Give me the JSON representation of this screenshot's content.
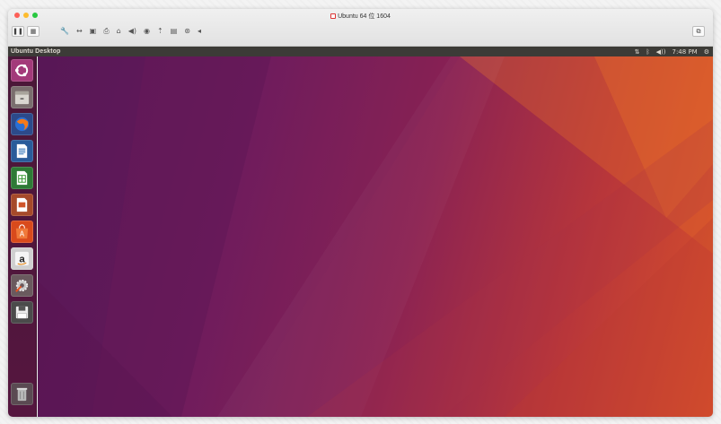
{
  "vm_window": {
    "title": "Ubuntu 64 位 1604",
    "traffic_lights": [
      "close",
      "minimize",
      "maximize"
    ],
    "toolbar": {
      "left_buttons": [
        {
          "name": "pause-button",
          "glyph": "❚❚"
        },
        {
          "name": "snapshot-button",
          "glyph": "▦"
        }
      ],
      "device_icons": [
        {
          "name": "settings-wrench-icon",
          "glyph": "🔧"
        },
        {
          "name": "resize-icon",
          "glyph": "↔"
        },
        {
          "name": "disk-icon",
          "glyph": "▣"
        },
        {
          "name": "printer-icon",
          "glyph": "⎙"
        },
        {
          "name": "camera-icon",
          "glyph": "⌂"
        },
        {
          "name": "sound-icon",
          "glyph": "◀)"
        },
        {
          "name": "usb-icon",
          "glyph": "◉"
        },
        {
          "name": "network-icon",
          "glyph": "⇡"
        },
        {
          "name": "floppy-icon",
          "glyph": "▤"
        },
        {
          "name": "cd-icon",
          "glyph": "⊛"
        },
        {
          "name": "more-arrow-icon",
          "glyph": "◂"
        }
      ],
      "right_button": {
        "name": "fullscreen-button",
        "glyph": "⧉"
      }
    }
  },
  "ubuntu": {
    "topbar": {
      "title": "Ubuntu Desktop",
      "indicators": {
        "network": "⇅",
        "bluetooth": "ᛒ",
        "volume": "◀))",
        "time": "7:48 PM",
        "settings": "⚙"
      }
    },
    "launcher": [
      {
        "name": "dash-home",
        "color": "#dd4814"
      },
      {
        "name": "files",
        "color": "#8a8a8a"
      },
      {
        "name": "firefox",
        "color": "#e66000"
      },
      {
        "name": "libreoffice-writer",
        "color": "#2a6fb6"
      },
      {
        "name": "libreoffice-calc",
        "color": "#3a9a35"
      },
      {
        "name": "libreoffice-impress",
        "color": "#d0552a"
      },
      {
        "name": "ubuntu-software",
        "color": "#e95420"
      },
      {
        "name": "amazon",
        "color": "#e8e8e8"
      },
      {
        "name": "system-settings",
        "color": "#7a6a6a"
      },
      {
        "name": "floppy",
        "color": "#555555"
      },
      {
        "name": "trash",
        "color": "#777777"
      }
    ],
    "colors": {
      "launcher_bg": "#4a1738",
      "panel_bg": "#3c3b37",
      "wallpaper_start": "#5c1a5a",
      "wallpaper_end": "#d9522a"
    }
  }
}
